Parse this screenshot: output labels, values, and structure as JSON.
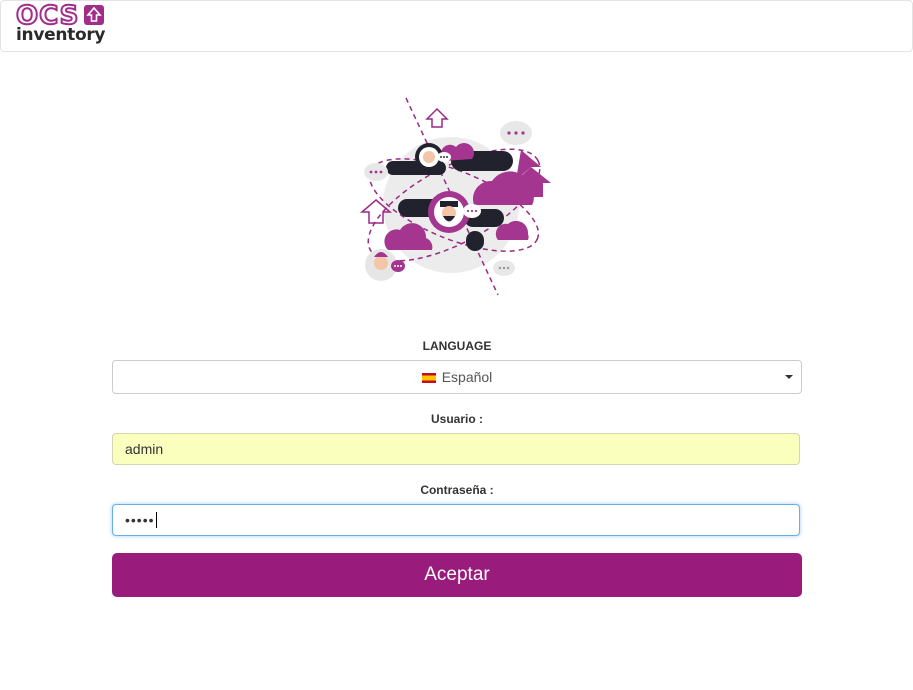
{
  "header": {
    "logo_text_top": "OCS",
    "logo_text_bottom": "inventory",
    "logo_icon": "arrow-up-icon"
  },
  "illustration": {
    "name": "network-people-illustration"
  },
  "form": {
    "language_label": "LANGUAGE",
    "language_value": "Español",
    "language_flag": "spain-flag-icon",
    "user_label": "Usuario :",
    "user_value": "admin",
    "password_label": "Contraseña :",
    "password_value": "•••••",
    "submit_label": "Aceptar"
  },
  "colors": {
    "brand": "#991c7d",
    "autofill": "#faffbd",
    "focus": "#66afe9"
  }
}
